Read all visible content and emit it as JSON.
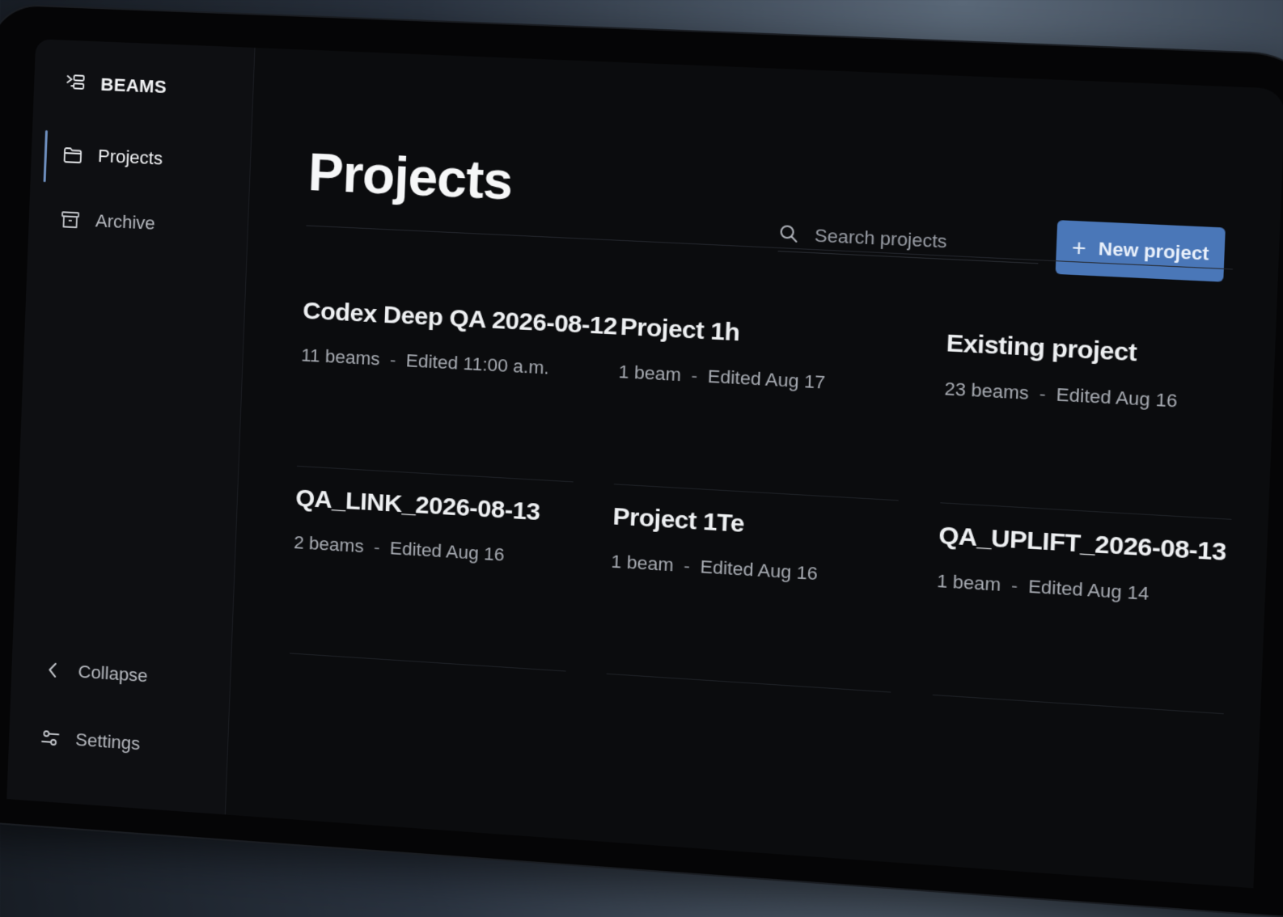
{
  "app": {
    "brand": "BEAMS"
  },
  "sidebar": {
    "items": [
      {
        "label": "Projects",
        "icon": "folder-icon",
        "active": true
      },
      {
        "label": "Archive",
        "icon": "archive-icon",
        "active": false
      }
    ],
    "footer": [
      {
        "label": "Collapse",
        "icon": "chevron-left-icon"
      },
      {
        "label": "Settings",
        "icon": "sliders-icon"
      }
    ]
  },
  "main": {
    "title": "Projects",
    "search": {
      "placeholder": "Search projects",
      "value": ""
    },
    "new_project_label": "New project",
    "accent_color": "#4a77b8",
    "projects": [
      {
        "name": "Codex Deep QA 2026-08-12",
        "beams": "11 beams",
        "edited": "Edited 11:00 a.m."
      },
      {
        "name": "Project 1h",
        "beams": "1 beam",
        "edited": "Edited Aug 17"
      },
      {
        "name": "Existing project",
        "beams": "23 beams",
        "edited": "Edited Aug 16"
      },
      {
        "name": "QA_LINK_2026-08-13",
        "beams": "2 beams",
        "edited": "Edited Aug 16"
      },
      {
        "name": "Project 1Te",
        "beams": "1 beam",
        "edited": "Edited Aug 16"
      },
      {
        "name": "QA_UPLIFT_2026-08-13",
        "beams": "1 beam",
        "edited": "Edited Aug 14"
      }
    ],
    "separator": "-"
  }
}
